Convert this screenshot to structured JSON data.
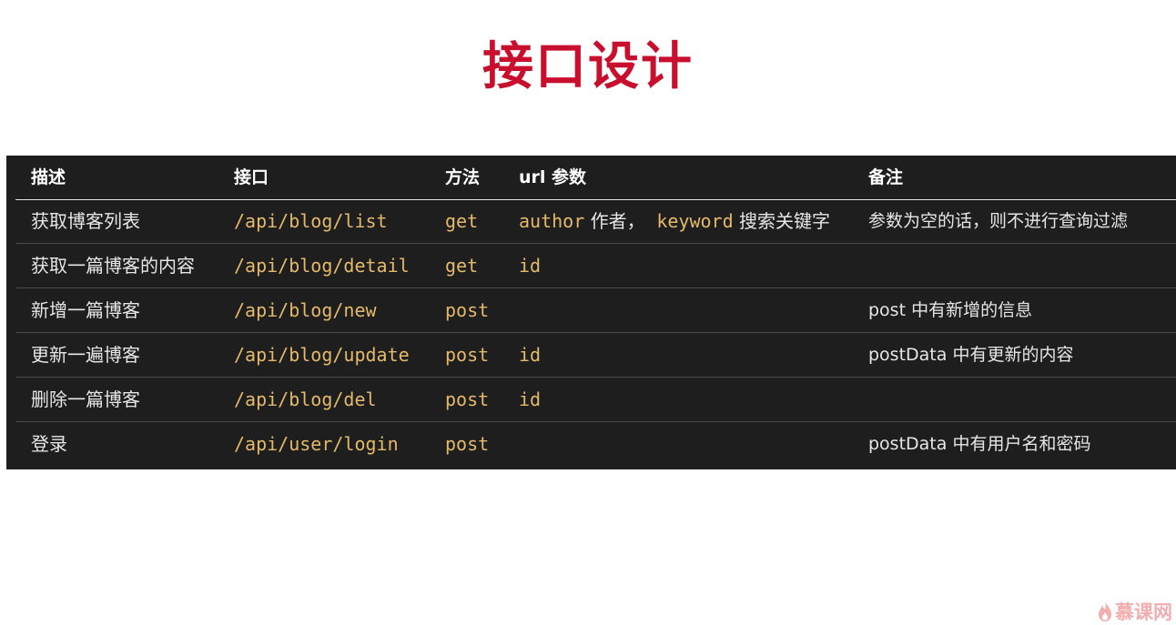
{
  "title": "接口设计",
  "table": {
    "headers": [
      "描述",
      "接口",
      "方法",
      "url 参数",
      "备注"
    ],
    "rows": [
      {
        "desc": "获取博客列表",
        "api": "/api/blog/list",
        "method": "get",
        "params": [
          {
            "code": "author",
            "text": " 作者，"
          },
          {
            "code": "keyword",
            "text": " 搜索关键字"
          }
        ],
        "note": "参数为空的话，则不进行查询过滤"
      },
      {
        "desc": "获取一篇博客的内容",
        "api": "/api/blog/detail",
        "method": "get",
        "params": [
          {
            "code": "id",
            "text": ""
          }
        ],
        "note": ""
      },
      {
        "desc": "新增一篇博客",
        "api": "/api/blog/new",
        "method": "post",
        "params": [],
        "note": "post 中有新增的信息"
      },
      {
        "desc": "更新一遍博客",
        "api": "/api/blog/update",
        "method": "post",
        "params": [
          {
            "code": "id",
            "text": ""
          }
        ],
        "note": "postData 中有更新的内容"
      },
      {
        "desc": "删除一篇博客",
        "api": "/api/blog/del",
        "method": "post",
        "params": [
          {
            "code": "id",
            "text": ""
          }
        ],
        "note": ""
      },
      {
        "desc": "登录",
        "api": "/api/user/login",
        "method": "post",
        "params": [],
        "note": "postData 中有用户名和密码"
      }
    ]
  },
  "watermark": {
    "text": "慕课网",
    "icon": "flame-icon",
    "color": "#ef9a9a"
  },
  "colors": {
    "title": "#c8102e",
    "table_bg": "#1e1e1e",
    "code": "#e3b96a",
    "text": "#e6e6e6"
  }
}
